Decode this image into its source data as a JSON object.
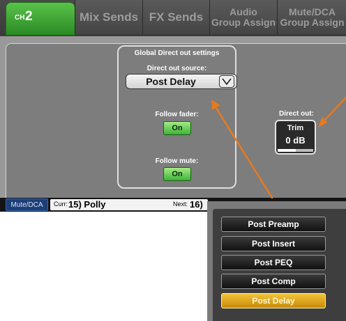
{
  "tabs": {
    "channel_prefix": "CH",
    "channel_number": "2",
    "mix_sends": "Mix Sends",
    "fx_sends": "FX Sends",
    "audio_group_line1": "Audio",
    "audio_group_line2": "Group Assign",
    "mute_dca_line1": "Mute/DCA",
    "mute_dca_line2": "Group Assign"
  },
  "global_direct_out": {
    "title": "Global Direct out settings",
    "source_label": "Direct out source:",
    "source_value": "Post Delay",
    "follow_fader_label": "Follow fader:",
    "follow_fader_value": "On",
    "follow_mute_label": "Follow mute:",
    "follow_mute_value": "On"
  },
  "direct_out": {
    "label": "Direct out:",
    "trim_label": "Trim",
    "trim_value": "0 dB",
    "trim_level_fraction": 0.5
  },
  "status_bar": {
    "mode_button": "Mute/DCA",
    "current_prefix": "Curr:",
    "current_name": "15) Polly",
    "next_prefix": "Next:",
    "next_name": "16)"
  },
  "source_options": [
    "Post Preamp",
    "Post Insert",
    "Post PEQ",
    "Post Comp",
    "Post Delay"
  ],
  "selected_option": "Post Delay",
  "colors": {
    "active_tab": "#3a9a30",
    "on_button": "#5cc24a",
    "selected_option": "#e0a620",
    "annotation_arrow": "#e87a1e"
  },
  "icons": {
    "dropdown": "chevron-down-icon"
  }
}
